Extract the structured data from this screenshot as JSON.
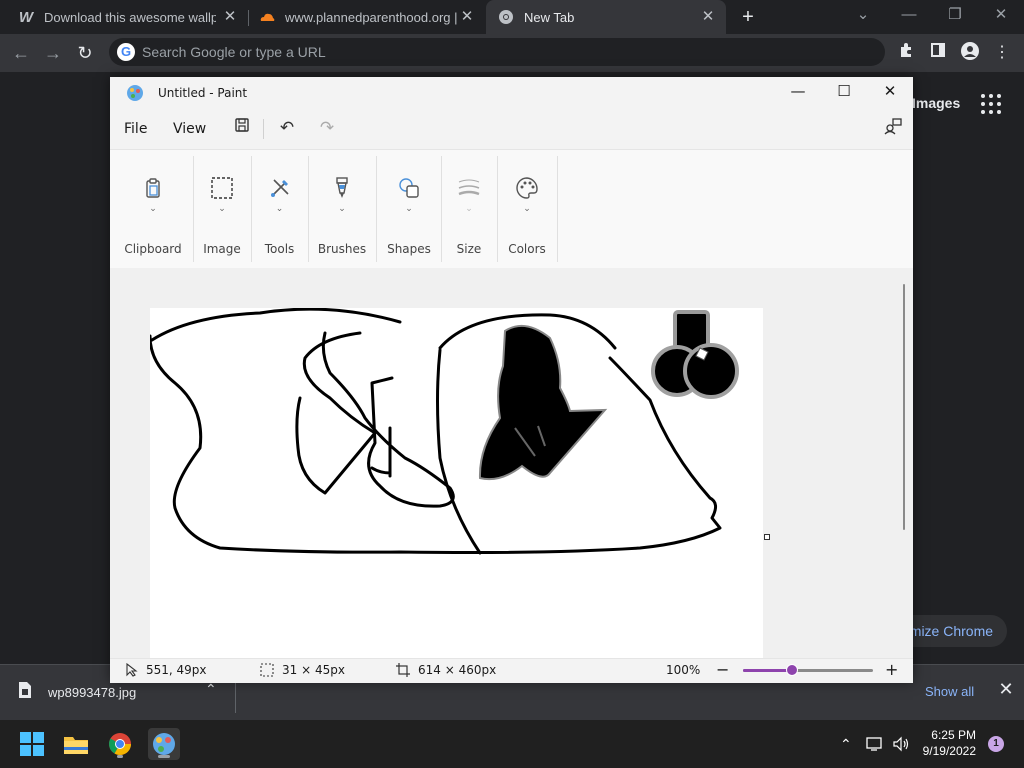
{
  "browser": {
    "tabs": [
      {
        "title": "Download this awesome wallpap",
        "favicon": "wallhaven-w-icon"
      },
      {
        "title": "www.plannedparenthood.org | C",
        "favicon": "cloudflare-icon"
      },
      {
        "title": "New Tab",
        "favicon": "chrome-icon",
        "active": true
      }
    ],
    "omnibox_placeholder": "Search Google or type a URL",
    "ntp": {
      "images_link": "Images",
      "customize_label": "omize Chrome"
    }
  },
  "downloads": {
    "file_name": "wp8993478.jpg",
    "show_all": "Show all"
  },
  "paint": {
    "title": "Untitled - Paint",
    "menu": {
      "file": "File",
      "view": "View"
    },
    "ribbon": [
      {
        "label": "Clipboard",
        "icon": "clipboard-icon"
      },
      {
        "label": "Image",
        "icon": "selection-icon"
      },
      {
        "label": "Tools",
        "icon": "tools-icon"
      },
      {
        "label": "Brushes",
        "icon": "brush-icon"
      },
      {
        "label": "Shapes",
        "icon": "shapes-icon"
      },
      {
        "label": "Size",
        "icon": "size-icon"
      },
      {
        "label": "Colors",
        "icon": "palette-icon"
      }
    ],
    "status": {
      "cursor_pos": "551, 49px",
      "selection_size": "31 × 45px",
      "canvas_size": "614 × 460px",
      "zoom": "100%",
      "zoom_slider_fraction": 0.38
    }
  },
  "taskbar": {
    "time": "6:25 PM",
    "date": "9/19/2022",
    "notification_count": "1"
  },
  "colors": {
    "accent": "#8e44ad",
    "chrome_bg": "#202124",
    "link": "#8ab4f8"
  }
}
